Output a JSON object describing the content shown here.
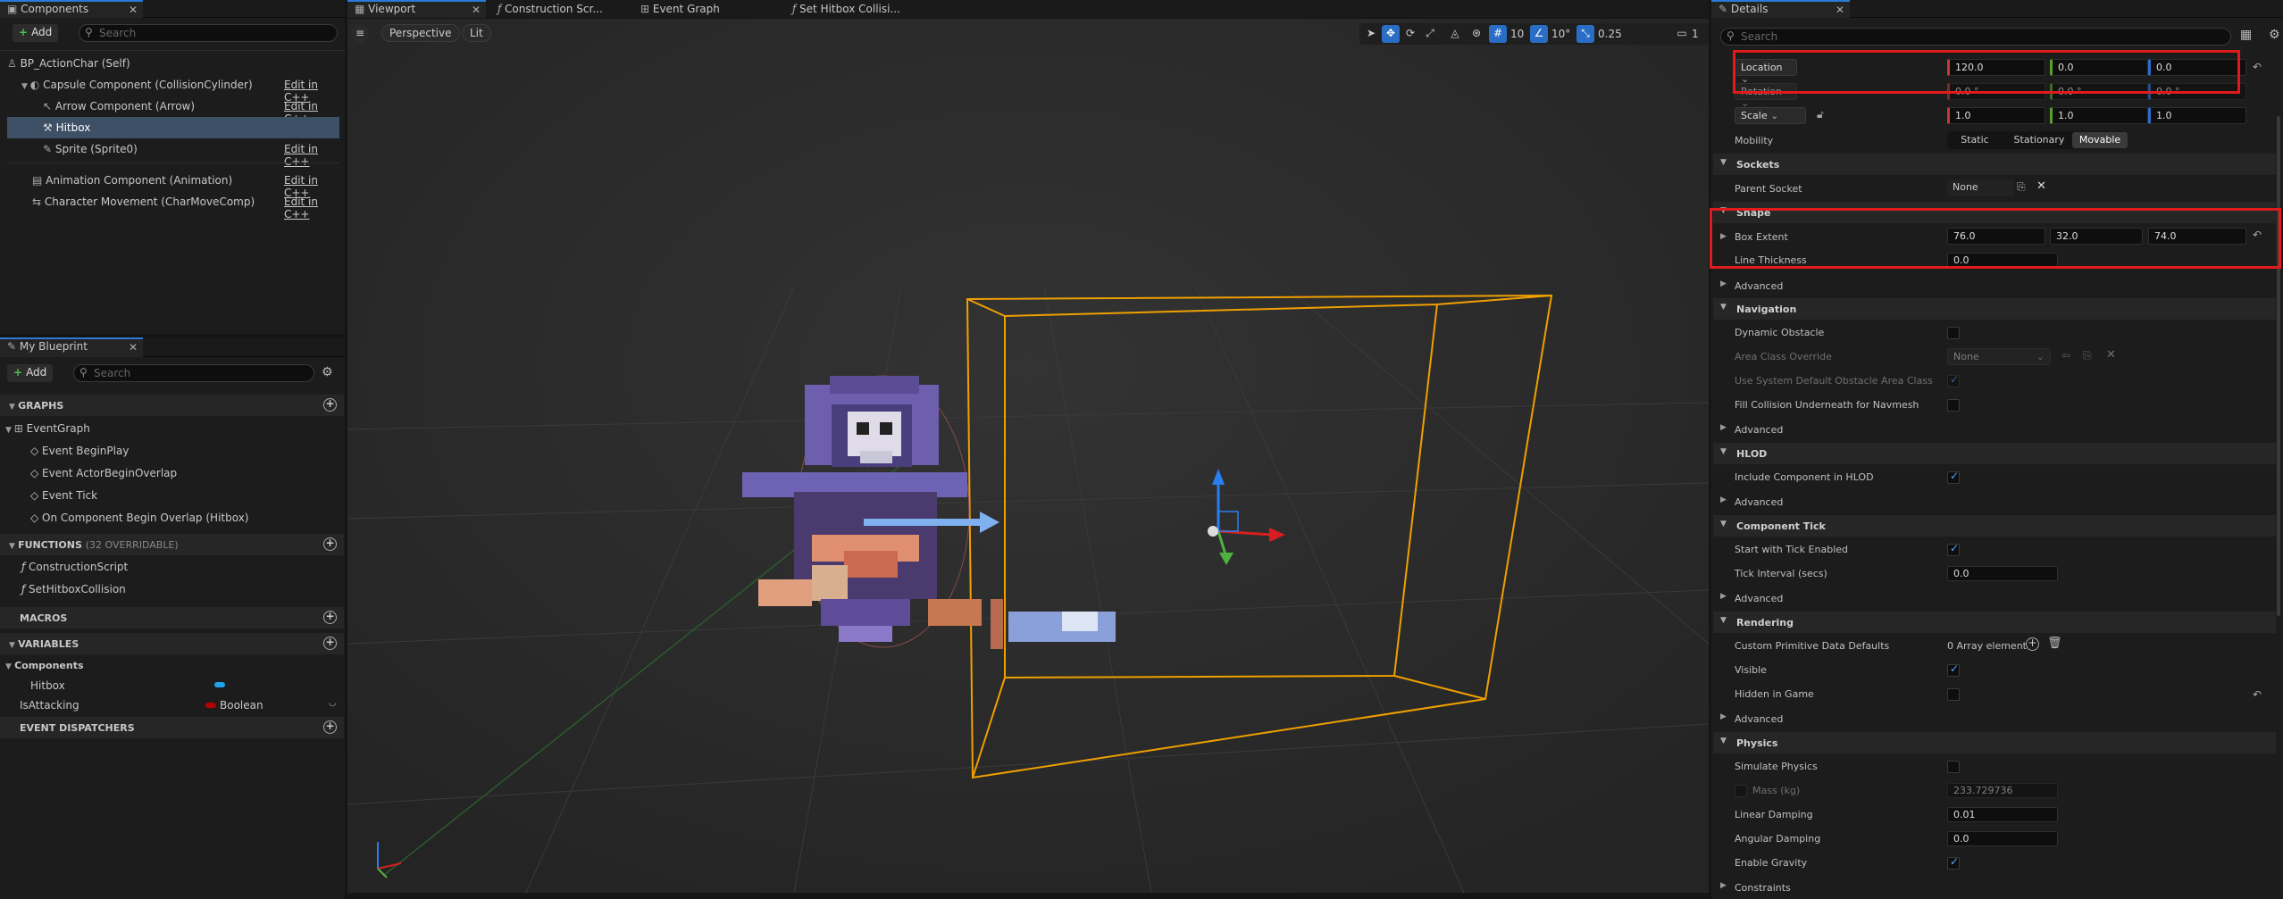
{
  "components_panel": {
    "tab_label": "Components",
    "add_label": "Add",
    "search_placeholder": "Search",
    "tree": [
      {
        "label": "BP_ActionChar (Self)",
        "edit": ""
      },
      {
        "label": "Capsule Component (CollisionCylinder)",
        "edit": "Edit in C++"
      },
      {
        "label": "Arrow Component (Arrow)",
        "edit": "Edit in C++"
      },
      {
        "label": "Hitbox",
        "edit": ""
      },
      {
        "label": "Sprite (Sprite0)",
        "edit": "Edit in C++"
      },
      {
        "label": "Animation Component (Animation)",
        "edit": "Edit in C++"
      },
      {
        "label": "Character Movement (CharMoveComp)",
        "edit": "Edit in C++"
      }
    ]
  },
  "blueprint_panel": {
    "tab_label": "My Blueprint",
    "add_label": "Add",
    "search_placeholder": "Search",
    "graphs_header": "GRAPHS",
    "graphs": [
      "EventGraph",
      "Event BeginPlay",
      "Event ActorBeginOverlap",
      "Event Tick",
      "On Component Begin Overlap (Hitbox)"
    ],
    "functions_header": "FUNCTIONS",
    "functions_count": "(32 OVERRIDABLE)",
    "functions": [
      "ConstructionScript",
      "SetHitboxCollision"
    ],
    "macros_header": "MACROS",
    "variables_header": "VARIABLES",
    "variables_group": "Components",
    "variables": [
      {
        "name": "Hitbox",
        "type": ""
      },
      {
        "name": "IsAttacking",
        "type": "Boolean"
      }
    ],
    "dispatchers_header": "EVENT DISPATCHERS"
  },
  "viewport": {
    "tabs": [
      "Viewport",
      "Construction Scr...",
      "Event Graph",
      "Set Hitbox Collisi..."
    ],
    "perspective_label": "Perspective",
    "lit_label": "Lit",
    "grid_snap": "10",
    "rot_snap": "10°",
    "scale_snap": "0.25",
    "camera_speed": "1"
  },
  "details": {
    "tab_label": "Details",
    "search_placeholder": "Search",
    "location_label": "Location",
    "location": [
      "120.0",
      "0.0",
      "0.0"
    ],
    "rotation_label": "Rotation",
    "rotation": [
      "0.0 °",
      "0.0 °",
      "0.0 °"
    ],
    "scale_label": "Scale",
    "scale": [
      "1.0",
      "1.0",
      "1.0"
    ],
    "mobility_label": "Mobility",
    "mobility_options": [
      "Static",
      "Stationary",
      "Movable"
    ],
    "sockets_header": "Sockets",
    "parent_socket_label": "Parent Socket",
    "parent_socket_value": "None",
    "shape_header": "Shape",
    "box_extent_label": "Box Extent",
    "box_extent": [
      "76.0",
      "32.0",
      "74.0"
    ],
    "line_thickness_label": "Line Thickness",
    "line_thickness": "0.0",
    "advanced_label": "Advanced",
    "navigation_header": "Navigation",
    "dynamic_obstacle_label": "Dynamic Obstacle",
    "area_class_label": "Area Class Override",
    "area_class_value": "None",
    "use_system_default_label": "Use System Default Obstacle Area Class",
    "fill_collision_label": "Fill Collision Underneath for Navmesh",
    "hlod_header": "HLOD",
    "include_hlod_label": "Include Component in HLOD",
    "tick_header": "Component Tick",
    "start_tick_label": "Start with Tick Enabled",
    "tick_interval_label": "Tick Interval (secs)",
    "tick_interval": "0.0",
    "rendering_header": "Rendering",
    "custom_prim_label": "Custom Primitive Data Defaults",
    "custom_prim_value": "0 Array element",
    "visible_label": "Visible",
    "hidden_label": "Hidden in Game",
    "physics_header": "Physics",
    "simulate_label": "Simulate Physics",
    "mass_label": "Mass (kg)",
    "mass_value": "233.729736",
    "linear_damping_label": "Linear Damping",
    "linear_damping": "0.01",
    "angular_damping_label": "Angular Damping",
    "angular_damping": "0.0",
    "gravity_label": "Enable Gravity",
    "constraints_label": "Constraints"
  }
}
